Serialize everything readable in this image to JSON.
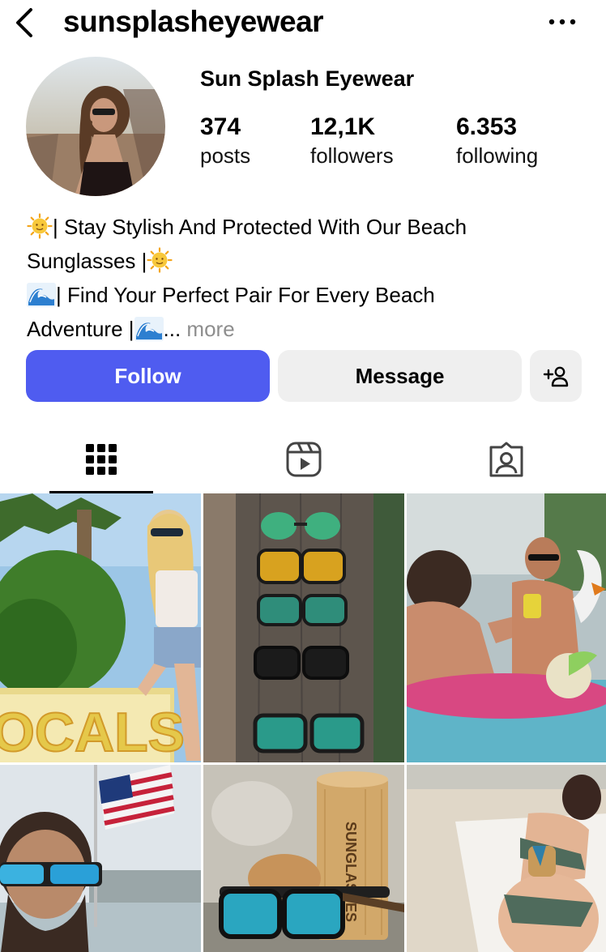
{
  "header": {
    "handle": "sunsplasheyewear",
    "back_icon": "chevron-left-icon",
    "more_icon": "ellipsis-icon"
  },
  "profile": {
    "display_name": "Sun Splash Eyewear",
    "stats": [
      {
        "value": "374",
        "label": "posts"
      },
      {
        "value": "12,1K",
        "label": "followers"
      },
      {
        "value": "6.353",
        "label": "following"
      }
    ]
  },
  "bio": {
    "line1": "| Stay Stylish And Protected With Our Beach",
    "line2": "Sunglasses |",
    "line3": "| Find Your Perfect Pair For Every Beach",
    "line4": "Adventure |",
    "ellipsis": "...",
    "more_label": "more",
    "emoji_sun": "sun-with-face-emoji",
    "emoji_wave": "water-wave-emoji"
  },
  "actions": {
    "follow_label": "Follow",
    "message_label": "Message",
    "add_user_icon": "add-user-icon"
  },
  "tabs": [
    {
      "name": "grid",
      "icon": "grid-icon",
      "active": true
    },
    {
      "name": "reels",
      "icon": "reels-icon",
      "active": false
    },
    {
      "name": "tagged",
      "icon": "tagged-icon",
      "active": false
    }
  ],
  "posts": [
    {
      "image": "woman-with-sunglasses-by-locals-sign"
    },
    {
      "image": "sunglasses-on-wooden-board"
    },
    {
      "image": "men-in-pool-with-float"
    },
    {
      "image": "man-with-blue-sunglasses-and-flag"
    },
    {
      "image": "sunglasses-with-bamboo-case"
    },
    {
      "image": "woman-lying-on-beach-towel"
    }
  ],
  "colors": {
    "follow_button": "#4f5cf0",
    "secondary_button": "#efefef",
    "muted_text": "#8e8e8e"
  }
}
